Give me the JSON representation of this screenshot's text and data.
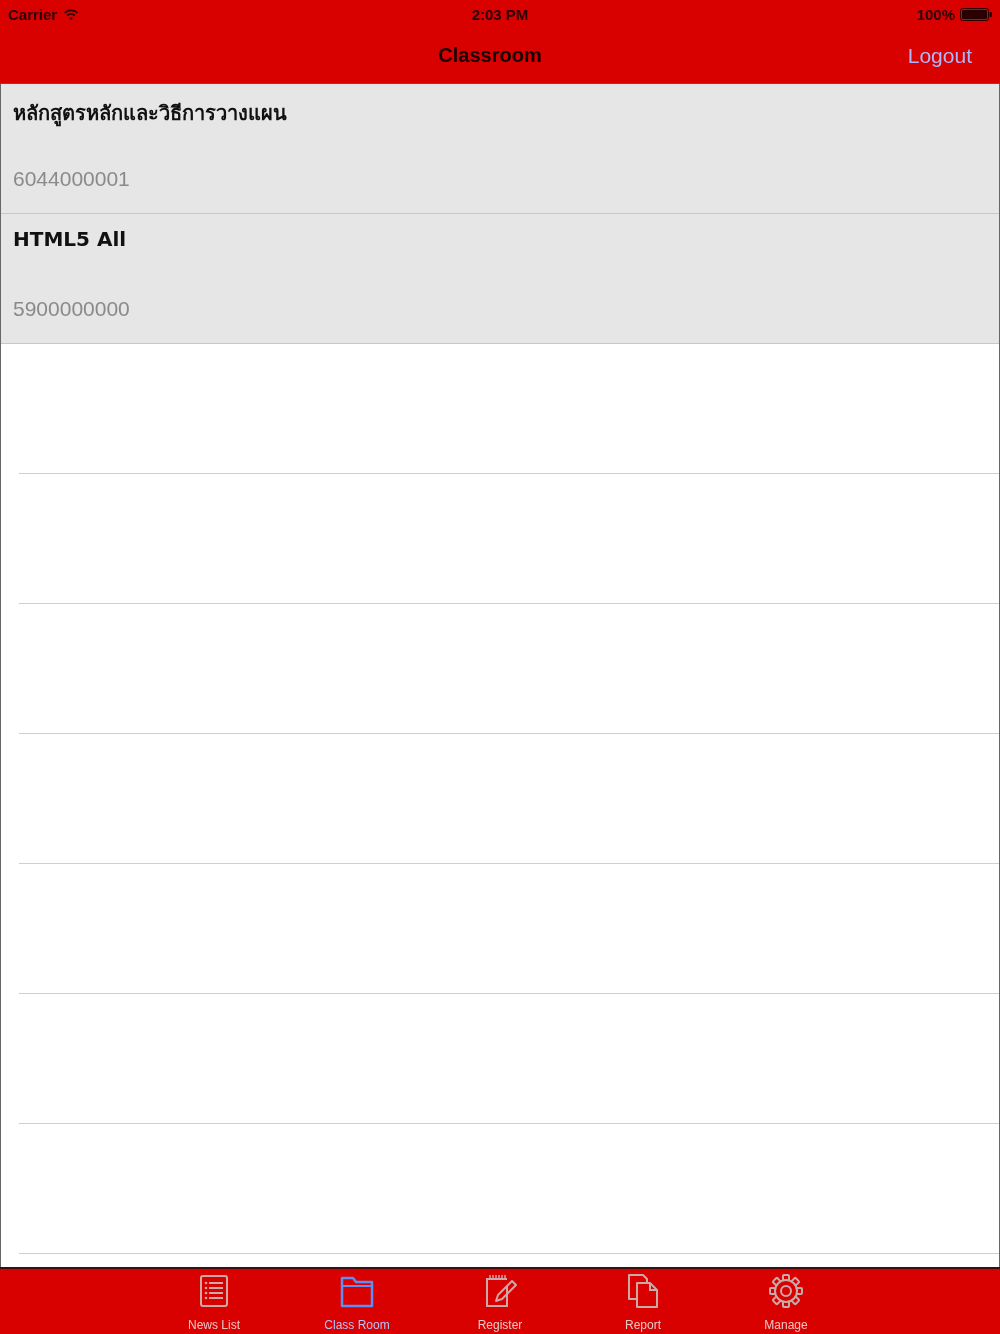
{
  "status_bar": {
    "carrier": "Carrier",
    "time": "2:03 PM",
    "battery": "100%"
  },
  "nav_bar": {
    "title": "Classroom",
    "logout": "Logout"
  },
  "classes": [
    {
      "title": "หลักสูตรหลักและวิธีการวางแผน",
      "code": "6044000001"
    },
    {
      "title": "HTML5 All",
      "code": "5900000000"
    }
  ],
  "tab_bar": [
    {
      "label": "News List",
      "selected": false
    },
    {
      "label": "Class Room",
      "selected": true
    },
    {
      "label": "Register",
      "selected": false
    },
    {
      "label": "Report",
      "selected": false
    },
    {
      "label": "Manage",
      "selected": false
    }
  ]
}
